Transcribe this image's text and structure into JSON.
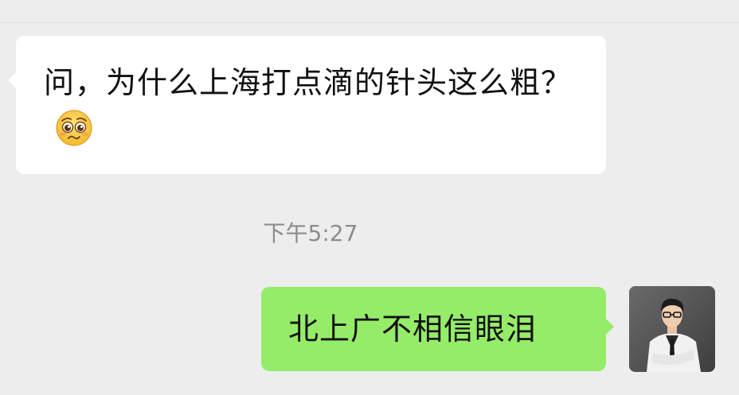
{
  "messages": [
    {
      "direction": "incoming",
      "text": "问，为什么上海打点滴的针头这么粗？",
      "emoji": "pleading-face-emoji",
      "bubble_color": "#ffffff"
    },
    {
      "direction": "outgoing",
      "text": "北上广不相信眼泪",
      "bubble_color": "#95ec69"
    }
  ],
  "timestamp": "下午5:27",
  "colors": {
    "background": "#ededed",
    "outgoing_bubble": "#95ec69",
    "incoming_bubble": "#ffffff",
    "timestamp_text": "#8c8c8c"
  }
}
